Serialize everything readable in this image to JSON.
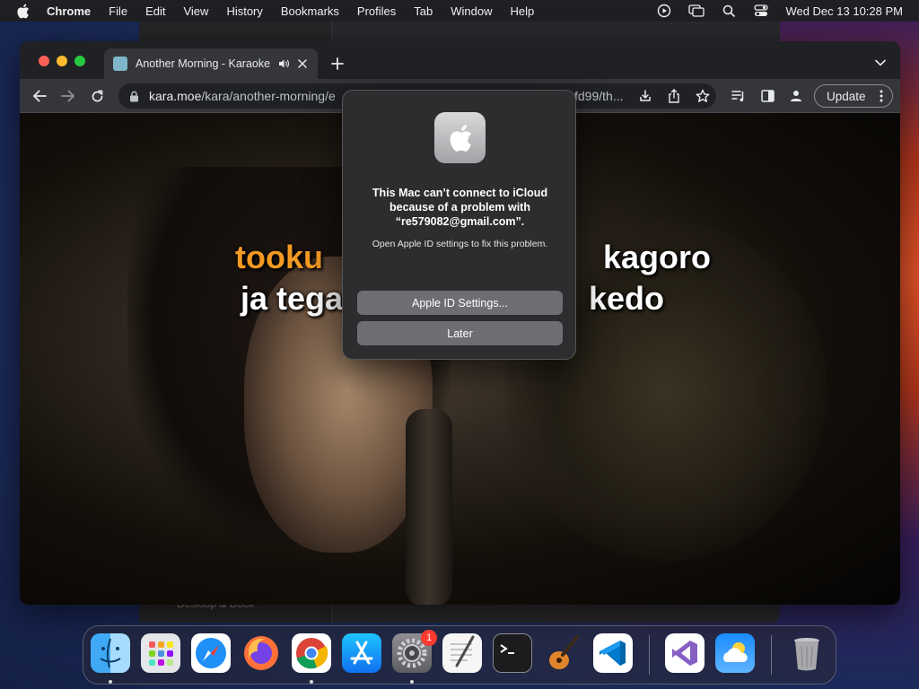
{
  "menubar": {
    "app_name": "Chrome",
    "menus": [
      "File",
      "Edit",
      "View",
      "History",
      "Bookmarks",
      "Profiles",
      "Tab",
      "Window",
      "Help"
    ],
    "clock": "Wed Dec 13  10:28 PM",
    "status_icons": [
      "screen-record-icon",
      "screen-mirroring-icon",
      "spotlight-search-icon",
      "control-center-icon"
    ]
  },
  "background_window": {
    "sidebar_label": "Desktop & Dock"
  },
  "browser": {
    "tab": {
      "title": "Another Morning - Karaoke",
      "favicon": "kara-moe-favicon"
    },
    "omnibox": {
      "host": "kara.moe",
      "path": "/kara/another-morning/e",
      "tail": "fd99/th..."
    },
    "update_label": "Update",
    "colors": {
      "frame": "#202124",
      "toolbar": "#35363a",
      "omnibox": "#202124"
    }
  },
  "video": {
    "lyric_line1_left": "tooku",
    "lyric_line1_right": "kagoro",
    "lyric_line2_left": "ja tega",
    "lyric_line2_right": "kedo",
    "highlight_color": "#f39a22"
  },
  "alert": {
    "icon": "apple-logo-icon",
    "heading": "This Mac can’t connect to iCloud because of a problem with “re579082@gmail.com”.",
    "body": "Open Apple ID settings to fix this problem.",
    "primary_button": "Apple ID Settings...",
    "secondary_button": "Later"
  },
  "dock": {
    "items": [
      {
        "name": "Finder",
        "icon": "finder-icon"
      },
      {
        "name": "Launchpad",
        "icon": "launchpad-icon"
      },
      {
        "name": "Safari",
        "icon": "safari-icon"
      },
      {
        "name": "Firefox",
        "icon": "firefox-icon"
      },
      {
        "name": "Chrome",
        "icon": "chrome-icon"
      },
      {
        "name": "App Store",
        "icon": "app-store-icon"
      },
      {
        "name": "System Settings",
        "icon": "system-settings-icon",
        "badge": "1"
      },
      {
        "name": "TextEdit",
        "icon": "textedit-icon"
      },
      {
        "name": "Terminal",
        "icon": "terminal-icon"
      },
      {
        "name": "GarageBand",
        "icon": "garageband-icon"
      },
      {
        "name": "Visual Studio Code",
        "icon": "vscode-icon"
      },
      {
        "name": "Visual Studio",
        "icon": "visual-studio-icon"
      },
      {
        "name": "Weather",
        "icon": "weather-icon"
      },
      {
        "name": "Trash",
        "icon": "trash-icon"
      }
    ]
  }
}
